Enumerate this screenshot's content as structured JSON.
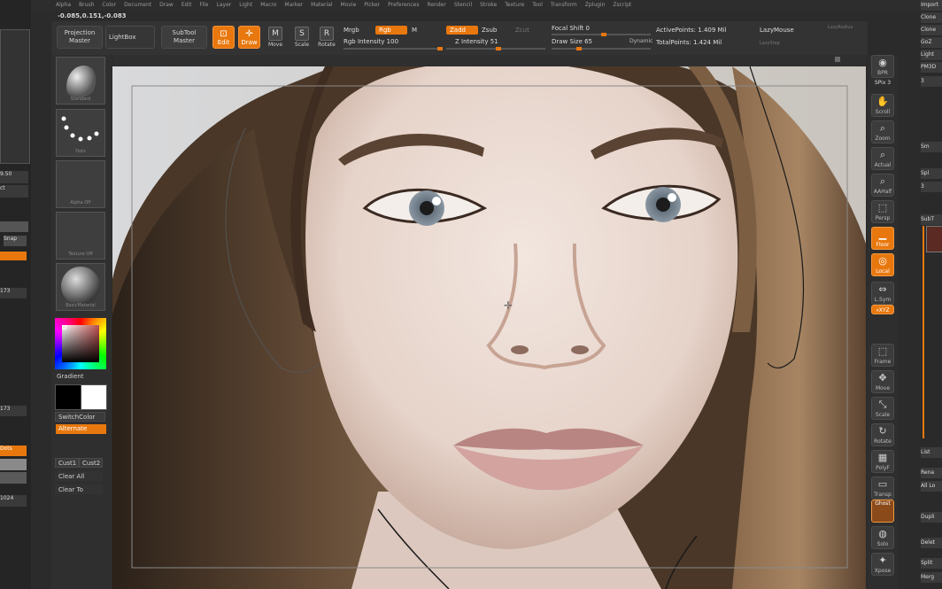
{
  "menu": [
    "Alpha",
    "Brush",
    "Color",
    "Document",
    "Draw",
    "Edit",
    "File",
    "Layer",
    "Light",
    "Macro",
    "Marker",
    "Material",
    "Movie",
    "Picker",
    "Preferences",
    "Render",
    "Stencil",
    "Stroke",
    "Texture",
    "Tool",
    "Transform",
    "Zplugin",
    "Zscript"
  ],
  "coords": "-0.085,0.151,-0.083",
  "toolbar": {
    "projection_master": "Projection Master",
    "lightbox": "LightBox",
    "subtool_master": "SubTool Master",
    "edit": "Edit",
    "draw": "Draw",
    "move": "Move",
    "scale": "Scale",
    "rotate": "Rotate",
    "mrgb": "Mrgb",
    "rgb": "Rgb",
    "m": "M",
    "rgb_intensity": "Rgb Intensity 100",
    "zadd": "Zadd",
    "zsub": "Zsub",
    "zcut": "Zcut",
    "z_intensity": "Z Intensity 51",
    "focal_shift": "Focal Shift 0",
    "draw_size": "Draw Size 65",
    "dynamic": "Dynamic",
    "active_points": "ActivePoints: 1.409 Mil",
    "total_points": "TotalPoints: 1.424 Mil",
    "lazymouse": "LazyMouse",
    "lazyradius": "LazyRadius",
    "lazystep": "LazyStep"
  },
  "left_tools": {
    "standard": "Standard",
    "dots": "Dots",
    "alpha_off": "Alpha Off",
    "texture_off": "Texture Off",
    "material": "BasicMaterial",
    "gradient": "Gradient",
    "switch_color": "SwitchColor",
    "alternate": "Alternate",
    "cust1": "Cust1",
    "cust2": "Cust2",
    "clear_all": "Clear All",
    "clear_to": "Clear To"
  },
  "left_tray": {
    "v1": "9.50",
    "v2": "ct",
    "snap": "Snap",
    "v3": "173",
    "v4": "173",
    "dots": "Dots",
    "v5": "1024"
  },
  "right_tools": {
    "bpr": "BPR",
    "spix": "SPix 3",
    "scroll": "Scroll",
    "zoom": "Zoom",
    "actual": "Actual",
    "aahalf": "AAHalf",
    "persp": "Persp",
    "floor": "Floor",
    "local": "Local",
    "lsym": "L.Sym",
    "xyz": "»XYZ",
    "frame": "Frame",
    "move": "Move",
    "scale": "Scale",
    "rotate": "Rotate",
    "polyf": "PolyF",
    "transp": "Transp",
    "ghost": "Ghost",
    "solo": "Solo",
    "xpose": "Xpose"
  },
  "right_panel": [
    "Import",
    "Clone",
    "Clone",
    "GoZ",
    "Light",
    "PM3D",
    "3",
    "Sm",
    "Spl",
    "3",
    "SubT",
    "List",
    "Rena",
    "All Lo",
    "Dupli",
    "Delet",
    "Split",
    "Merg"
  ],
  "colors": {
    "accent": "#e8780e",
    "bg": "#2b2b2b",
    "button": "#3d3d3d"
  }
}
